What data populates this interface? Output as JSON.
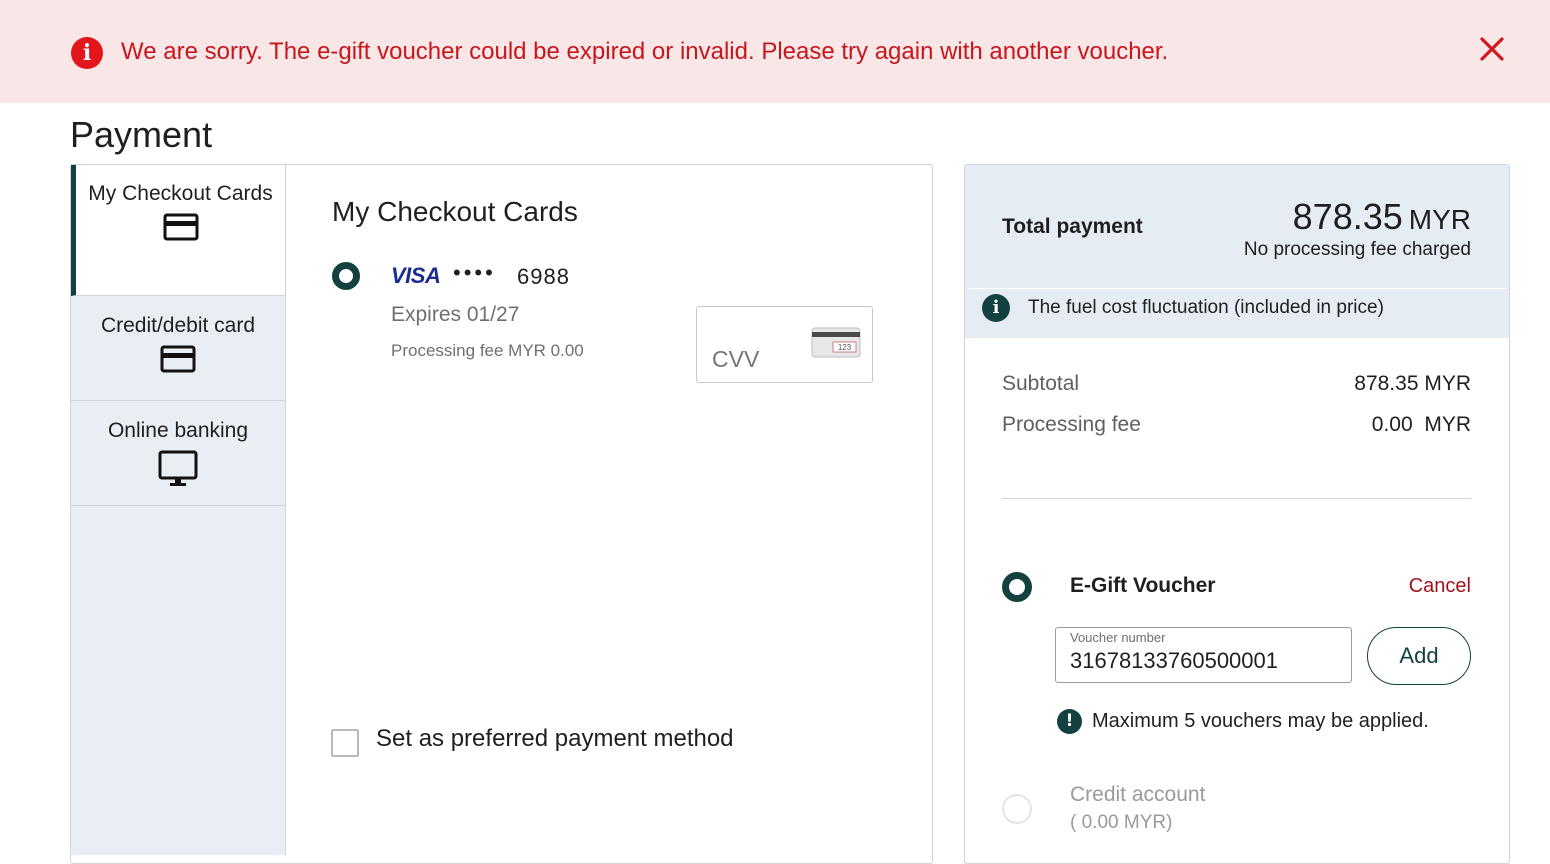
{
  "banner": {
    "message": "We are sorry. The e-gift voucher could be expired or invalid. Please try again with another voucher.",
    "icon": "error-icon",
    "close_icon": "close-icon",
    "color": "#c8161d"
  },
  "page": {
    "title": "Payment"
  },
  "tabs": [
    {
      "label": "My Checkout Cards",
      "icon": "credit-card-icon",
      "selected": true
    },
    {
      "label": "Credit/debit card",
      "icon": "credit-card-icon",
      "selected": false
    },
    {
      "label": "Online banking",
      "icon": "monitor-icon",
      "selected": false
    }
  ],
  "checkout": {
    "title": "My Checkout Cards",
    "card": {
      "brand": "VISA",
      "mask": "••••",
      "last4": "6988",
      "expires": "Expires 01/27",
      "processing_fee": "Processing fee MYR 0.00"
    },
    "cvv_placeholder": "CVV",
    "cvv_card_hint": "123",
    "preferred_label": "Set as preferred payment method"
  },
  "summary": {
    "total_label": "Total payment",
    "total_amount": "878.35",
    "total_currency": "MYR",
    "no_fee": "No processing fee charged",
    "info_text": "The fuel cost fluctuation (included in price)",
    "rows": [
      {
        "label": "Subtotal",
        "value": "878.35 MYR"
      },
      {
        "label": "Processing fee",
        "value": "0.00  MYR"
      }
    ]
  },
  "voucher": {
    "title": "E-Gift Voucher",
    "cancel": "Cancel",
    "field_label": "Voucher number",
    "value": "31678133760500001",
    "add": "Add",
    "warning": "Maximum 5 vouchers may be applied."
  },
  "credit": {
    "title": "Credit account",
    "amount": "( 0.00 MYR)"
  },
  "colors": {
    "accent": "#12413f",
    "error": "#c8161d",
    "banner_bg": "#f9e7e7",
    "panel_bg": "#e6ecf4"
  }
}
